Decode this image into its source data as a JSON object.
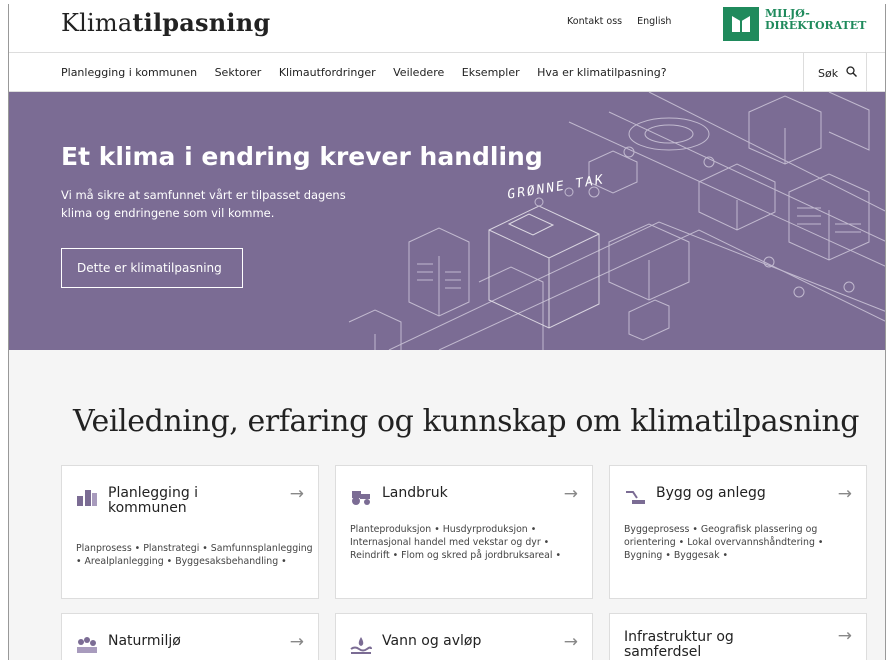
{
  "header": {
    "logo_regular": "Klima",
    "logo_bold": "tilpasning",
    "links": [
      "Kontakt oss",
      "English"
    ],
    "agency_line1": "MILJØ-",
    "agency_line2": "DIREKTORATET"
  },
  "nav": {
    "items": [
      "Planlegging i kommunen",
      "Sektorer",
      "Klimautfordringer",
      "Veiledere",
      "Eksempler",
      "Hva er klimatilpasning?"
    ],
    "search_label": "Søk"
  },
  "hero": {
    "title": "Et klima i endring krever handling",
    "subtitle": "Vi må sikre at samfunnet vårt er tilpasset dagens klima og endringene som vil komme.",
    "button_label": "Dette er klimatilpasning",
    "illustration_label": "GRØNNE TAK",
    "bg_color": "#7b6c94"
  },
  "main": {
    "heading": "Veiledning, erfaring og kunnskap om klimatilpasning",
    "cards": [
      {
        "title": "Planlegging i kommunen",
        "icon": "planning-icon",
        "tags": "Planprosess • Planstrategi • Samfunnsplanlegging • Arealplanlegging • Byggesaksbehandling •"
      },
      {
        "title": "Landbruk",
        "icon": "tractor-icon",
        "tags": "Planteproduksjon • Husdyrproduksjon • Internasjonal handel med vekstar og dyr • Reindrift • Flom og skred på jordbruksareal •"
      },
      {
        "title": "Bygg og anlegg",
        "icon": "construction-icon",
        "tags": "Byggeprosess • Geografisk plassering og orientering • Lokal overvannshåndtering • Bygning • Byggesak •"
      },
      {
        "title": "Naturmiljø",
        "icon": "nature-icon",
        "tags": ""
      },
      {
        "title": "Vann og avløp",
        "icon": "water-icon",
        "tags": ""
      },
      {
        "title": "Infrastruktur og samferdsel",
        "icon": "",
        "tags": ""
      }
    ],
    "arrow": "→"
  },
  "colors": {
    "accent_green": "#1f8a5c",
    "card_border": "#dddddd"
  }
}
